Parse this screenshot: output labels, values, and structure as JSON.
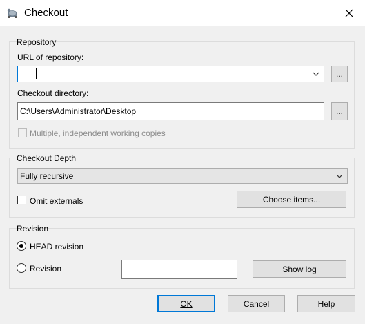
{
  "window": {
    "title": "Checkout",
    "icon": "tortoisesvn-icon",
    "close_glyph": "✕"
  },
  "repository": {
    "group_title": "Repository",
    "url_label": "URL of repository:",
    "url_value": "",
    "browse_glyph": "...",
    "dir_label": "Checkout directory:",
    "dir_value": "C:\\Users\\Administrator\\Desktop",
    "multiple_copies_label": "Multiple, independent working copies",
    "multiple_copies_checked": false,
    "multiple_copies_enabled": false
  },
  "depth": {
    "group_title": "Checkout Depth",
    "selected": "Fully recursive",
    "omit_externals_label": "Omit externals",
    "omit_externals_checked": false,
    "choose_items_label": "Choose items..."
  },
  "revision": {
    "group_title": "Revision",
    "head_label": "HEAD revision",
    "head_selected": true,
    "revision_label": "Revision",
    "revision_value": "",
    "show_log_label": "Show log"
  },
  "footer": {
    "ok_label": "OK",
    "cancel_label": "Cancel",
    "help_label": "Help"
  }
}
